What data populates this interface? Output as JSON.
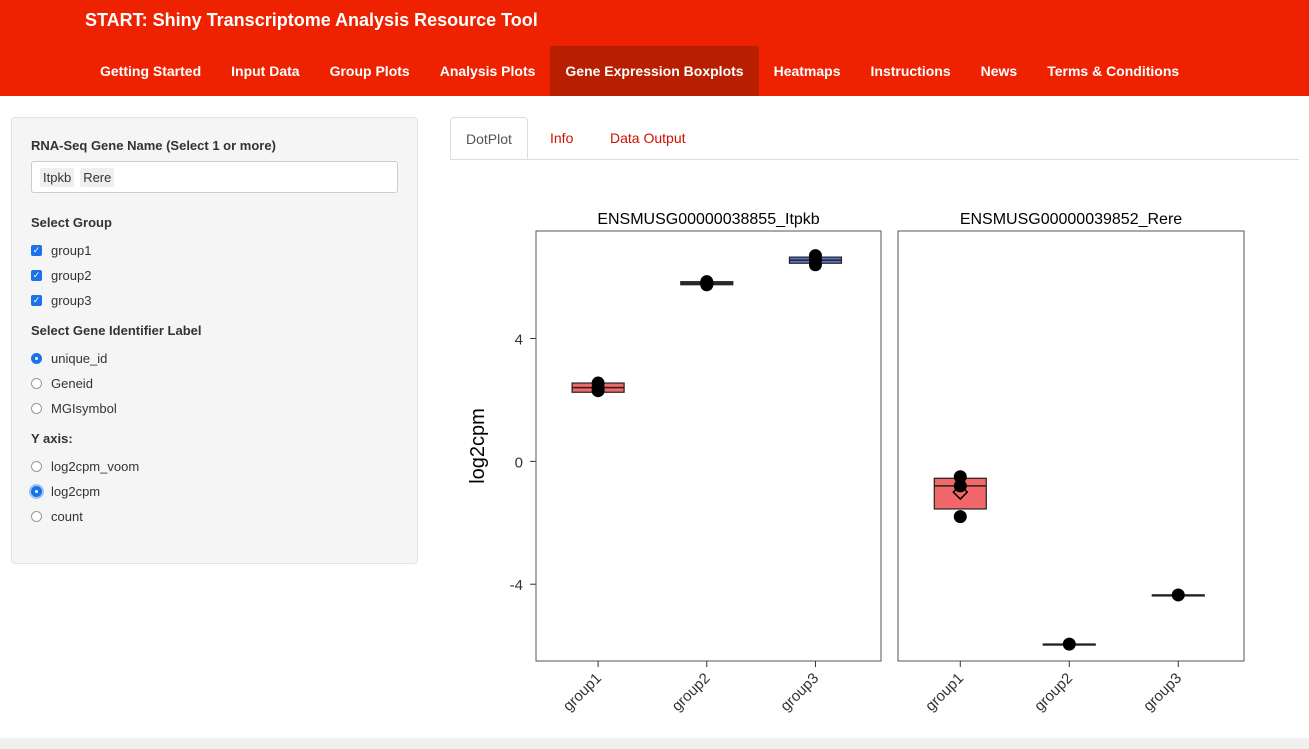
{
  "app": {
    "title": "START: Shiny Transcriptome Analysis Resource Tool"
  },
  "nav": {
    "items": [
      {
        "label": "Getting Started"
      },
      {
        "label": "Input Data"
      },
      {
        "label": "Group Plots"
      },
      {
        "label": "Analysis Plots"
      },
      {
        "label": "Gene Expression Boxplots"
      },
      {
        "label": "Heatmaps"
      },
      {
        "label": "Instructions"
      },
      {
        "label": "News"
      },
      {
        "label": "Terms & Conditions"
      }
    ],
    "active": "Gene Expression Boxplots"
  },
  "sidebar": {
    "gene_label": "RNA-Seq Gene Name (Select 1 or more)",
    "genes": [
      "Itpkb",
      "Rere"
    ],
    "group_label": "Select Group",
    "groups": [
      {
        "label": "group1",
        "checked": true
      },
      {
        "label": "group2",
        "checked": true
      },
      {
        "label": "group3",
        "checked": true
      }
    ],
    "id_label": "Select Gene Identifier Label",
    "ids": [
      {
        "label": "unique_id",
        "selected": true
      },
      {
        "label": "Geneid",
        "selected": false
      },
      {
        "label": "MGIsymbol",
        "selected": false
      }
    ],
    "y_label": "Y axis:",
    "y_options": [
      {
        "label": "log2cpm_voom",
        "selected": false
      },
      {
        "label": "log2cpm",
        "selected": true
      },
      {
        "label": "count",
        "selected": false
      }
    ]
  },
  "tabs": [
    {
      "label": "DotPlot"
    },
    {
      "label": "Info"
    },
    {
      "label": "Data Output"
    }
  ],
  "colors": {
    "navbar": "#ee2200",
    "accent": "#1a73e8",
    "group1": "#f0575a",
    "group2": "#2d5e3d",
    "group3": "#4a68c4"
  },
  "chart_data": {
    "type": "box",
    "ylabel": "log2cpm",
    "y_ticks": [
      -4,
      0,
      4
    ],
    "ylim": [
      -6.5,
      7.5
    ],
    "categories": [
      "group1",
      "group2",
      "group3"
    ],
    "panels": [
      {
        "title": "ENSMUSG00000038855_Itpkb",
        "boxes": [
          {
            "group": "group1",
            "q1": 2.25,
            "median": 2.4,
            "q3": 2.55,
            "points": [
              2.3,
              2.4,
              2.55
            ]
          },
          {
            "group": "group2",
            "q1": 5.75,
            "median": 5.8,
            "q3": 5.85,
            "points": [
              5.75,
              5.8,
              5.85
            ]
          },
          {
            "group": "group3",
            "q1": 6.45,
            "median": 6.55,
            "q3": 6.65,
            "points": [
              6.4,
              6.55,
              6.7
            ]
          }
        ]
      },
      {
        "title": "ENSMUSG00000039852_Rere",
        "boxes": [
          {
            "group": "group1",
            "q1": -1.55,
            "median": -0.8,
            "q3": -0.55,
            "mean": -1.0,
            "points": [
              -0.5,
              -0.8,
              -1.8
            ]
          },
          {
            "group": "group2",
            "q1": -5.95,
            "median": -5.95,
            "q3": -5.95,
            "points": [
              -5.95
            ]
          },
          {
            "group": "group3",
            "q1": -4.35,
            "median": -4.35,
            "q3": -4.35,
            "points": [
              -4.35
            ]
          }
        ]
      }
    ]
  }
}
